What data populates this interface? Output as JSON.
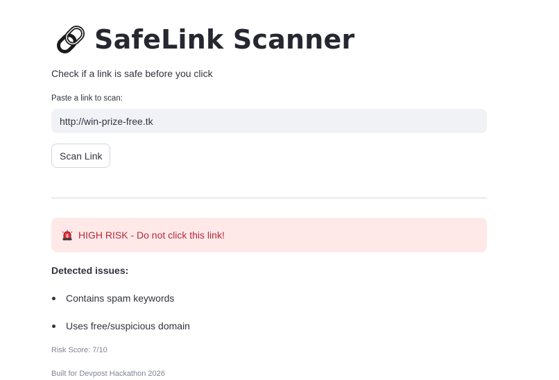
{
  "header": {
    "title": "SafeLink Scanner",
    "icon": "link-icon",
    "subtitle": "Check if a link is safe before you click"
  },
  "scan_form": {
    "label": "Paste a link to scan:",
    "value": "http://win-prize-free.tk",
    "button_label": "Scan Link"
  },
  "result": {
    "alert_icon": "siren-icon",
    "alert_text": "HIGH RISK - Do not click this link!",
    "alert_color": "#b6283a",
    "alert_background": "#ffe9e8",
    "issues_heading": "Detected issues:",
    "issues": [
      "Contains spam keywords",
      "Uses free/suspicious domain"
    ],
    "risk_score": "Risk Score: 7/10"
  },
  "footer": {
    "text": "Built for Devpost Hackathon 2026"
  }
}
